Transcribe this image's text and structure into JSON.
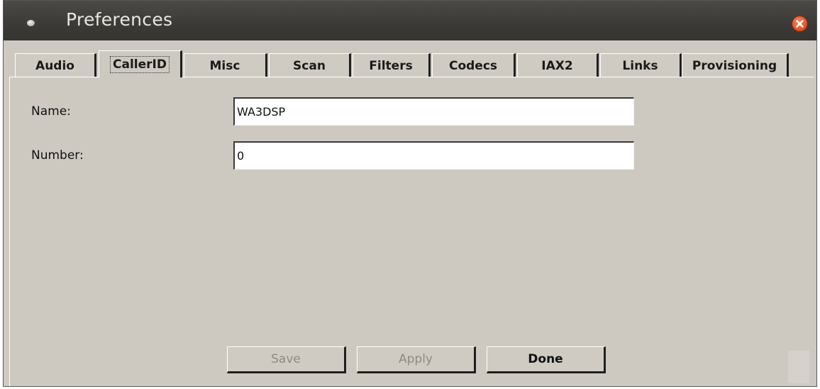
{
  "window": {
    "title": "Preferences"
  },
  "tabs": [
    {
      "label": "Audio"
    },
    {
      "label": "CallerID",
      "active": true
    },
    {
      "label": "Misc"
    },
    {
      "label": "Scan"
    },
    {
      "label": "Filters"
    },
    {
      "label": "Codecs"
    },
    {
      "label": "IAX2"
    },
    {
      "label": "Links"
    },
    {
      "label": "Provisioning"
    }
  ],
  "form": {
    "name_label": "Name:",
    "name_value": "WA3DSP",
    "number_label": "Number:",
    "number_value": "0"
  },
  "buttons": {
    "save_label": "Save",
    "apply_label": "Apply",
    "done_label": "Done"
  },
  "colors": {
    "titlebar": "#3b3a37",
    "window_bg": "#cdc9c1",
    "close_button": "#e0562a"
  },
  "icons": {
    "window_icon": "app-dot-icon",
    "close": "close-icon"
  }
}
